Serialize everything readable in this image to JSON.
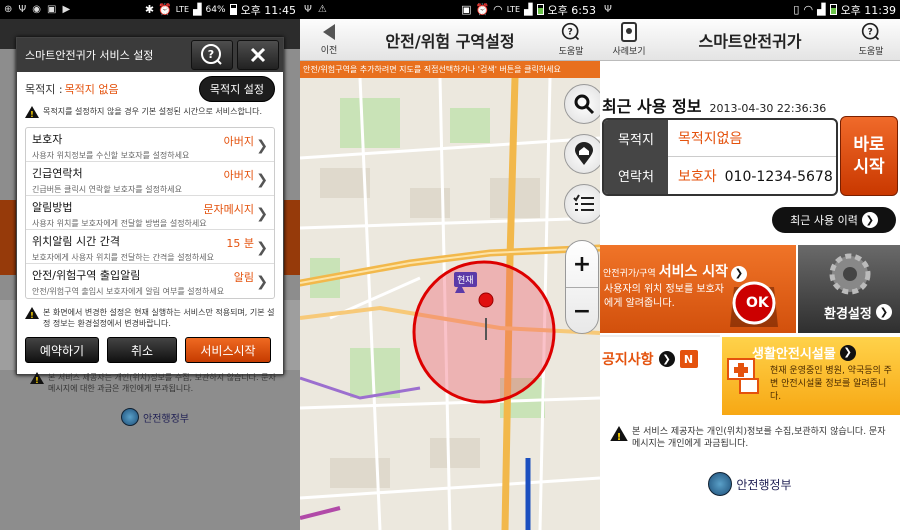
{
  "panel1": {
    "status": {
      "time": "오후 11:45",
      "battery": "64%",
      "lte": "LTE"
    },
    "dialog": {
      "title": "스마트안전귀가 서비스 설정",
      "dest_label": "목적지 :",
      "dest_value": "목적지 없음",
      "dest_button": "목적지 설정",
      "dest_note": "목적지를 설정하지 않을 경우 기본 설정된 시간으로 서비스합니다.",
      "items": [
        {
          "title": "보호자",
          "sub": "사용자 위치정보를 수신할 보호자를 설정하세요",
          "value": "아버지"
        },
        {
          "title": "긴급연락처",
          "sub": "긴급버튼 클릭시 연락할 보호자를 설정하세요",
          "value": "아버지"
        },
        {
          "title": "알림방법",
          "sub": "사용자 위치를 보호자에게 전달할 방법을 설정하세요",
          "value": "문자메시지"
        },
        {
          "title": "위치알림 시간 간격",
          "sub": "보호자에게 사용자 위치를 전달하는 간격을 설정하세요",
          "value": "15 분"
        },
        {
          "title": "안전/위험구역 출입알림",
          "sub": "안전/위험구역 출입시 보호자에게 알림 여부를 설정하세요",
          "value": "알림"
        }
      ],
      "bottom_note": "본 화면에서 변경한 설정은 현재 실행하는 서비스만 적용되며, 기본 설정 정보는 환경설정에서 변경바랍니다.",
      "btn_reserve": "예약하기",
      "btn_cancel": "취소",
      "btn_start": "서비스시작"
    },
    "footer_note": "본 서비스 제공자는 개인(위치)정보를 수집, 보관하지 않습니다. 문자메시지에 대한 과금은 개인에게 부과됩니다.",
    "gov": "안전행정부"
  },
  "panel2": {
    "status": {
      "time": "오후 6:53",
      "lte": "LTE"
    },
    "title": "안전/위험 구역설정",
    "back": "이전",
    "help": "도움말",
    "banner": "안전/위험구역을 추가하려면 지도를 직접선택하거나 '검색' 버튼을 클릭하세요",
    "current_label": "현재"
  },
  "panel3": {
    "status": {
      "time": "오후 11:39"
    },
    "title": "스마트안전귀가",
    "left_btn": "사례보기",
    "help": "도움말",
    "recent_title": "최근 사용 정보",
    "recent_date": "2013-04-30 22:36:36",
    "dest_label": "목적지",
    "dest_value": "목적지없음",
    "contact_label": "연락처",
    "contact_name": "보호자",
    "contact_number": "010-1234-5678",
    "go_line1": "바로",
    "go_line2": "시작",
    "history": "최근 사용 이력",
    "service_title_small": "안전귀가/구역",
    "service_title_big": "서비스 시작",
    "service_desc": "사용자의 위치 정보를 보호자에게 알려줍니다.",
    "ok": "OK",
    "settings": "환경설정",
    "notice": "공지사항",
    "notice_badge": "N",
    "facility_title": "생활안전시설물",
    "facility_desc": "현재 운영중인 병원, 약국등의 주변 안전시설물 정보를 알려줍니다.",
    "footer_note": "본 서비스 제공자는 개인(위치)정보를 수집,보관하지 않습니다. 문자메시지는 개인에게 과금됩니다.",
    "gov": "안전행정부"
  },
  "colors": {
    "accent": "#e65a10",
    "dark": "#333333",
    "red_zone": "#e02020"
  }
}
